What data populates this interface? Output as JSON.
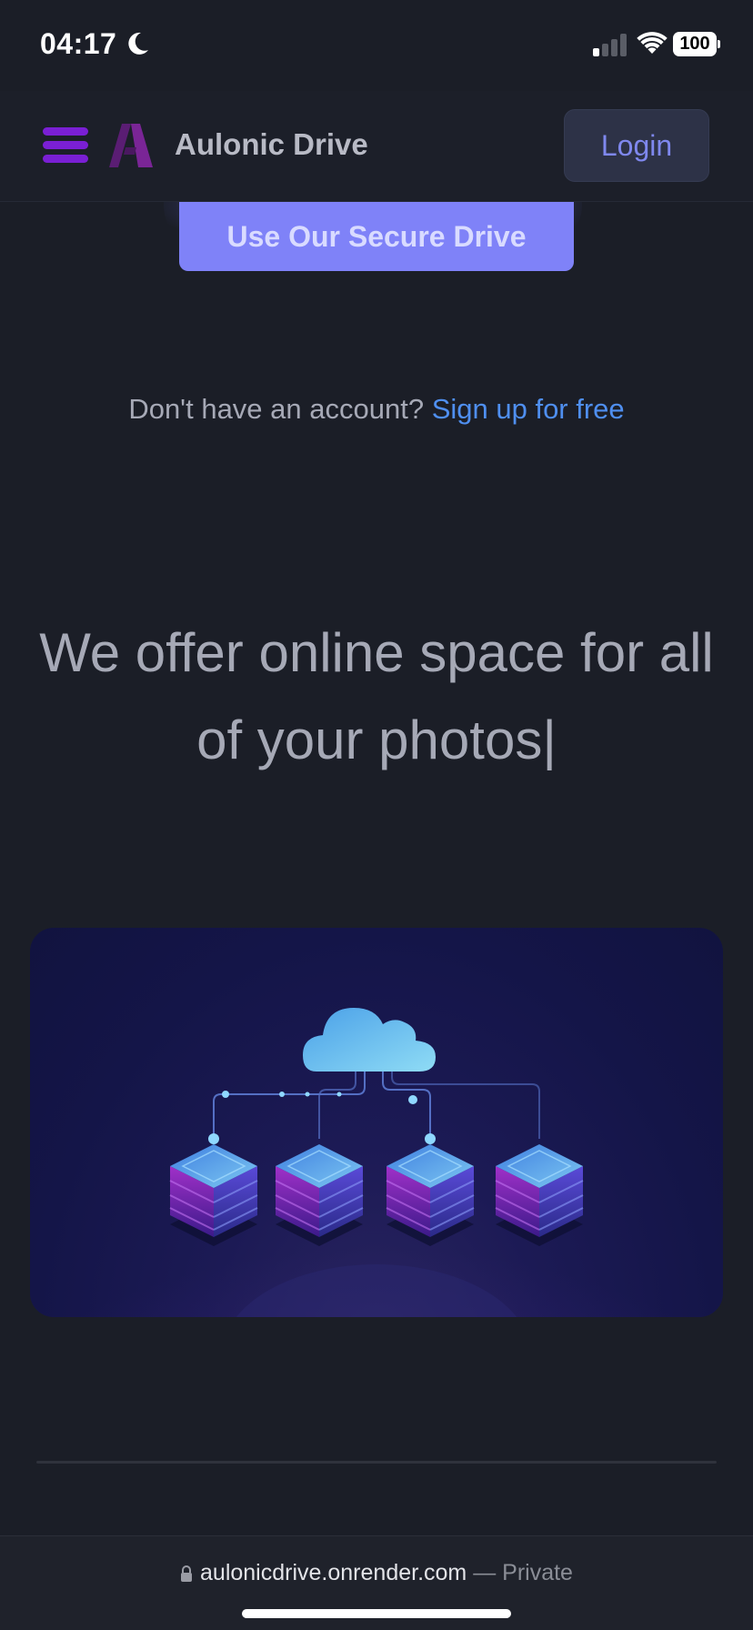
{
  "status_bar": {
    "time": "04:17",
    "battery": "100",
    "icons": [
      "moon-icon",
      "signal-icon",
      "wifi-icon",
      "battery-icon"
    ]
  },
  "navbar": {
    "brand_name": "Aulonic Drive",
    "login_label": "Login",
    "icons": [
      "menu-icon",
      "logo-icon"
    ],
    "menu_color": "#7a1fd4"
  },
  "hero": {
    "cta_label": "Use Our Secure Drive",
    "cta_color": "#7f82f8",
    "signup_prompt": "Don't have an account?",
    "signup_link": "Sign up for free",
    "link_color": "#4f8ff0",
    "headline_line1": "We offer online space for all",
    "headline_line2": "of your photos|"
  },
  "illustration": {
    "icons": [
      "cloud-icon",
      "server-stack-icon"
    ]
  },
  "browser": {
    "url": "aulonicdrive.onrender.com",
    "mode": "— Private"
  }
}
